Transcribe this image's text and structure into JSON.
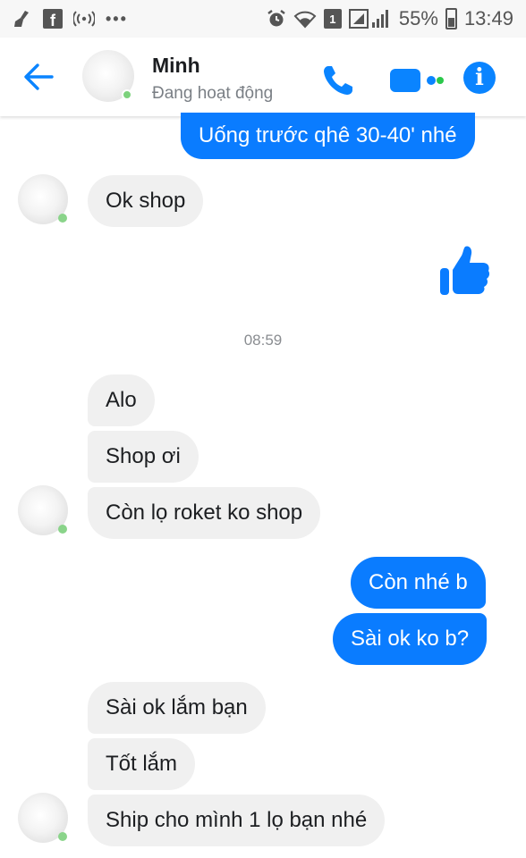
{
  "status_bar": {
    "dots": "•••",
    "sim_slot": "1",
    "battery": "55%",
    "time": "13:49"
  },
  "header": {
    "name": "Minh",
    "status": "Đang hoạt động",
    "info_glyph": "i"
  },
  "accent_color": "#0a7cff",
  "conversation": {
    "timestamp": "08:59",
    "messages": [
      {
        "from": "me",
        "text": "Uống trước qhê 30-40' nhé"
      },
      {
        "from": "contact",
        "text": "Ok shop"
      },
      {
        "from": "me",
        "type": "like",
        "icon": "thumbs-up-icon"
      },
      {
        "from": "contact",
        "text": "Alo"
      },
      {
        "from": "contact",
        "text": "Shop ơi"
      },
      {
        "from": "contact",
        "text": "Còn lọ roket ko shop"
      },
      {
        "from": "me",
        "text": "Còn nhé b"
      },
      {
        "from": "me",
        "text": "Sài ok ko b?"
      },
      {
        "from": "contact",
        "text": "Sài ok lắm bạn"
      },
      {
        "from": "contact",
        "text": "Tốt lắm"
      },
      {
        "from": "contact",
        "text": "Ship cho mình 1 lọ bạn nhé"
      }
    ]
  }
}
